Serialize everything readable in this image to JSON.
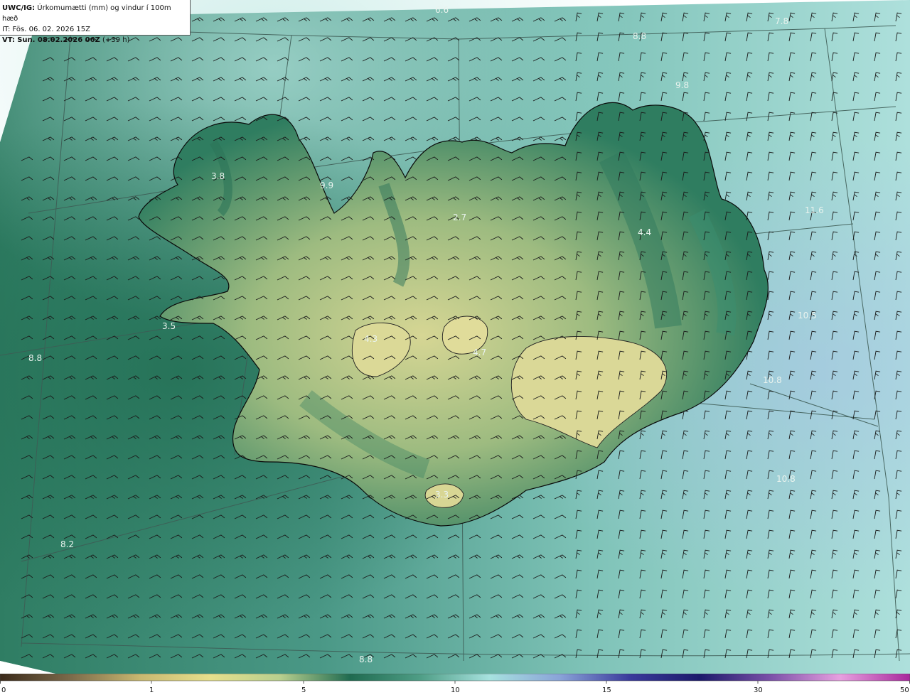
{
  "header": {
    "model": "UWC/IG:",
    "description": "Úrkomumætti (mm) og vindur í 100m hæð",
    "it_line": "IT: Fös. 06. 02. 2026 15Z",
    "vt_prefix": "VT:",
    "vt_time": "Sun. 08.02.2026 06Z",
    "vt_lead": "(+39 h)"
  },
  "map": {
    "labels": [
      {
        "text": "6.6"
      },
      {
        "text": "7.8"
      },
      {
        "text": "8.8"
      },
      {
        "text": "9.8"
      },
      {
        "text": "3.8"
      },
      {
        "text": "9.9"
      },
      {
        "text": "2.7"
      },
      {
        "text": "4.4"
      },
      {
        "text": "11.6"
      },
      {
        "text": "3.5"
      },
      {
        "text": "4.3"
      },
      {
        "text": "4.7"
      },
      {
        "text": "10.5"
      },
      {
        "text": "8.8"
      },
      {
        "text": "10.8"
      },
      {
        "text": "3.3"
      },
      {
        "text": "10.8"
      },
      {
        "text": "8.2"
      },
      {
        "text": "8.8"
      }
    ]
  },
  "colorbar": {
    "ticks": [
      "0",
      "1",
      "5",
      "10",
      "15",
      "30",
      "50"
    ],
    "colors": [
      "#3c2a1a",
      "#7b6a4a",
      "#c8b870",
      "#e6e08c",
      "#b8cf8e",
      "#1f6b50",
      "#4f9e86",
      "#a7e2df",
      "#8aa3d8",
      "#3a3a9c",
      "#1c1a6b",
      "#7a4fa8",
      "#e7a0e0",
      "#a8289c"
    ]
  },
  "colors": {
    "sea": "#5ea899",
    "land_low": "#2f7a5e",
    "land_high": "#d2d38f",
    "coast": "#0a0a0a"
  }
}
